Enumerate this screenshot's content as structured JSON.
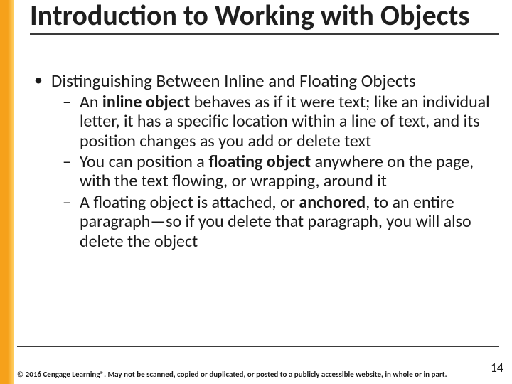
{
  "title": "Introduction to Working with Objects",
  "lvl1_text": "Distinguishing Between Inline and Floating Objects",
  "b1_pre": "An ",
  "b1_bold": "inline object ",
  "b1_post": "behaves as if it were text; like an individual letter, it has a specific location within a line of text, and its position changes as you add or delete text",
  "b2_pre": "You can position a ",
  "b2_bold": "floating object ",
  "b2_post": "anywhere on the page, with the text flowing, or wrapping, around it",
  "b3_pre": "A floating object is attached, or ",
  "b3_bold": "anchored",
  "b3_post": ", to an entire paragraph—so if you delete that paragraph, you will also delete the object",
  "copyright": "© 2016 Cengage Learning®. May not be scanned, copied or duplicated, or posted to a publicly accessible website, in whole or in part.",
  "page_number": "14",
  "colors": {
    "accent": "#f6a11a"
  }
}
